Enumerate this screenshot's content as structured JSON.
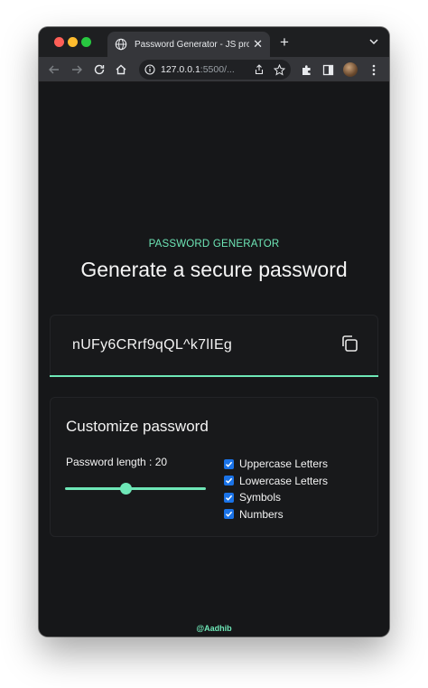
{
  "browser": {
    "tab_title": "Password Generator - JS proje",
    "tab_close": "✕",
    "new_tab": "+",
    "url_host": "127.0.0.1",
    "url_rest": ":5500/..."
  },
  "app": {
    "eyebrow": "PASSWORD GENERATOR",
    "headline": "Generate a secure password",
    "password": "nUFy6CRrf9qQL^k7lIEg",
    "customize_title": "Customize password",
    "length_label": "Password length : 20",
    "length_fraction": 0.43,
    "options": [
      {
        "label": "Uppercase Letters",
        "checked": true
      },
      {
        "label": "Lowercase Letters",
        "checked": true
      },
      {
        "label": "Symbols",
        "checked": true
      },
      {
        "label": "Numbers",
        "checked": true
      }
    ],
    "credit": "@Aadhib"
  },
  "colors": {
    "accent": "#6ee7b7",
    "background": "#161719",
    "checkbox": "#1a73e8"
  }
}
